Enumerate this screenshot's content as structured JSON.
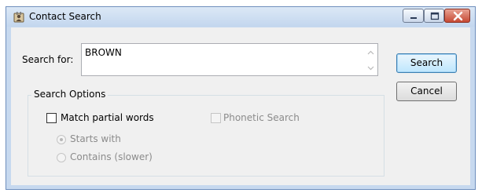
{
  "window": {
    "title": "Contact Search",
    "icons": {
      "app": "contact-book-icon",
      "minimize": "minimize-icon",
      "maximize": "maximize-icon",
      "close": "close-icon"
    }
  },
  "search": {
    "label": "Search for:",
    "value": "BROWN"
  },
  "buttons": {
    "search": "Search",
    "cancel": "Cancel"
  },
  "options": {
    "group_title": "Search Options",
    "match_partial": {
      "label": "Match partial words",
      "checked": false,
      "enabled": true
    },
    "phonetic": {
      "label": "Phonetic Search",
      "checked": false,
      "enabled": false
    },
    "starts_with": {
      "label": "Starts with",
      "selected": true,
      "enabled": false
    },
    "contains": {
      "label": "Contains (slower)",
      "selected": false,
      "enabled": false
    }
  },
  "colors": {
    "frame": "#c7d9ef",
    "client": "#f0f0f0",
    "close_button": "#c74a34",
    "disabled_text": "#8b8b8b"
  }
}
